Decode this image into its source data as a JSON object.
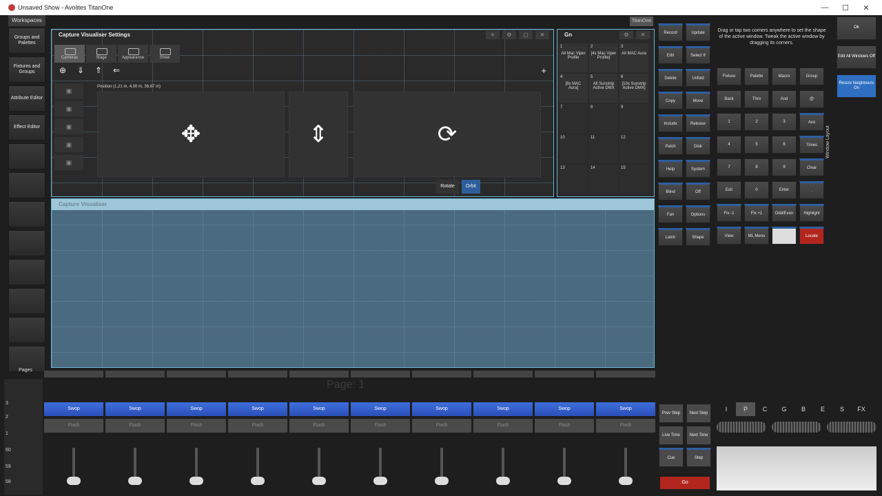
{
  "window": {
    "title": "Unsaved Show - Avolites TitanOne",
    "minimize": "—",
    "maximize": "☐",
    "close": "✕"
  },
  "workspaces": {
    "label": "Workspaces",
    "items": [
      "Groups and Palettes",
      "Fixtures and Groups",
      "Attribute Editor",
      "Effect Editor",
      "",
      "",
      "",
      "",
      "",
      "",
      "",
      ""
    ]
  },
  "titanone_tab": "TitanOne",
  "capture_settings": {
    "title": "Capture Visualiser Settings",
    "tabs": [
      "Cameras",
      "Stage",
      "Appearance",
      "Show"
    ],
    "position_label": "Position (1,21 m, 4,00 m, 36,67 m)",
    "rotate": "Rotate",
    "orbit": "Orbit",
    "plus": "+"
  },
  "visualiser": {
    "title": "Capture Visualiser"
  },
  "gn": {
    "title": "Gn",
    "cells": [
      {
        "n": "1",
        "t": "All Mac Viper Profile"
      },
      {
        "n": "2",
        "t": "[4x Mac Viper Profile]"
      },
      {
        "n": "3",
        "t": "All MAC Aura"
      },
      {
        "n": "4",
        "t": "[8x MAC Aura]"
      },
      {
        "n": "5",
        "t": "All Sunstrip Active DMX"
      },
      {
        "n": "6",
        "t": "[10x Sunstrip Active DMX]"
      },
      {
        "n": "7",
        "t": ""
      },
      {
        "n": "8",
        "t": ""
      },
      {
        "n": "9",
        "t": ""
      },
      {
        "n": "10",
        "t": ""
      },
      {
        "n": "11",
        "t": ""
      },
      {
        "n": "12",
        "t": ""
      },
      {
        "n": "13",
        "t": ""
      },
      {
        "n": "14",
        "t": ""
      },
      {
        "n": "15",
        "t": ""
      }
    ]
  },
  "commands": [
    "Record",
    "Update",
    "Edit",
    "Select If",
    "Delete",
    "Unfold",
    "Copy",
    "Move",
    "Include",
    "Release",
    "Patch",
    "Disk",
    "Help",
    "System",
    "Blind",
    "Off",
    "Fan",
    "Options",
    "Latch",
    "Shape"
  ],
  "hint": "Drag or tap two corners anywhere to set the shape of the active window. Tweak the active window by dragging its corners.",
  "keypad": [
    "Fixture",
    "Palette",
    "Macro",
    "Group",
    "Back",
    "Thro",
    "And",
    "@",
    "1",
    "2",
    "3",
    "Avo",
    "4",
    "5",
    "6",
    "Times",
    "7",
    "8",
    "9",
    "Clear",
    "Exit",
    "0",
    "Enter",
    ".",
    "Fix -1",
    "Fix +1",
    "Odd/Even",
    "Highlight",
    "View",
    "ML Menu",
    "",
    "Locate"
  ],
  "window_layout": "Window Layout",
  "right_buttons": [
    "Ok",
    "Edit All Windows Off",
    "Resize Neighbours On"
  ],
  "pages": {
    "label": "Pages",
    "text": "Page: 1",
    "numbers": [
      "3",
      "2",
      "1",
      "60",
      "59",
      "58"
    ]
  },
  "faders": {
    "swop": "Swop",
    "flash": "Flash",
    "count": 10
  },
  "playback": [
    "Prev Step",
    "Next Step",
    "Live Time",
    "Next Time",
    "Cue",
    "Step"
  ],
  "go": "Go",
  "attr_letters": [
    "I",
    "P",
    "C",
    "G",
    "B",
    "E",
    "S",
    "FX"
  ]
}
